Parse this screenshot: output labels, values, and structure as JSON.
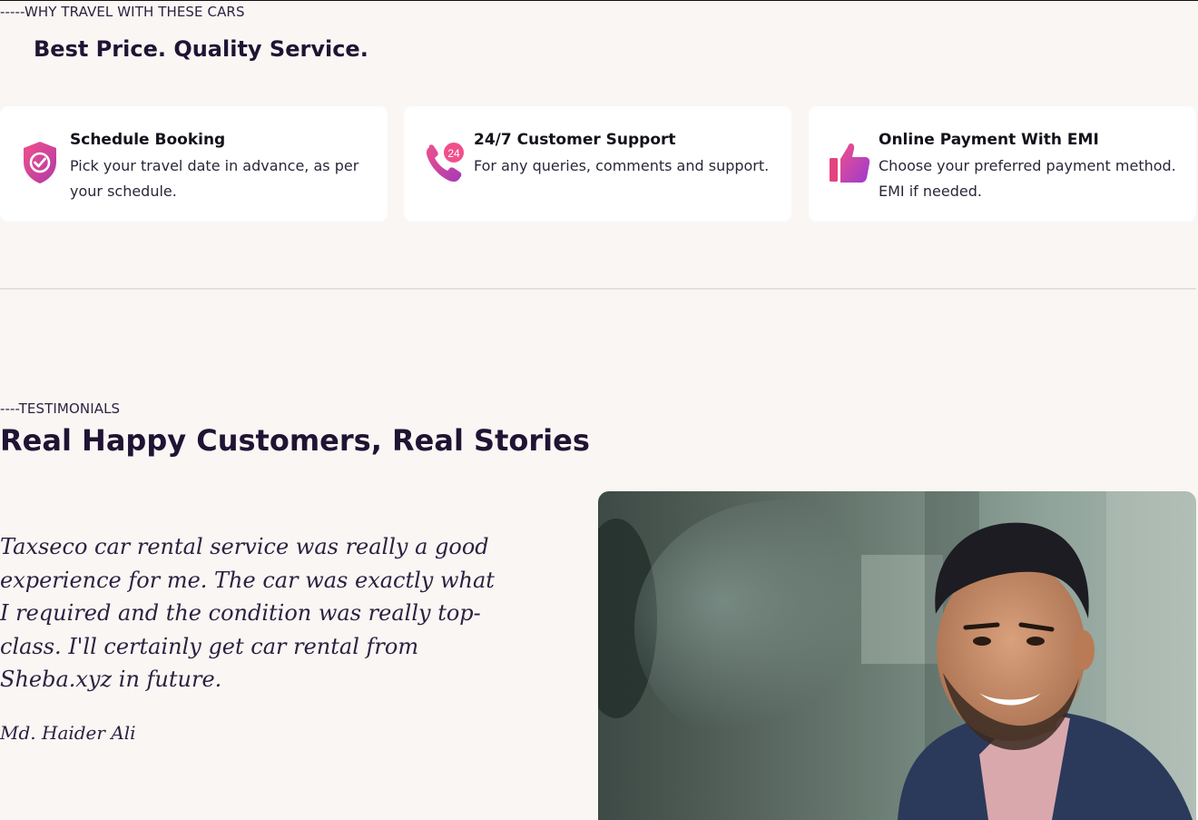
{
  "why_travel": {
    "eyebrow": "-----WHY TRAVEL WITH THESE CARS",
    "title": "Best Price. Quality Service.",
    "features": [
      {
        "icon": "shield-check-icon",
        "title": "Schedule Booking",
        "description": "Pick your travel date in advance, as per your schedule."
      },
      {
        "icon": "phone-24-icon",
        "title": "24/7 Customer Support",
        "description": "For any queries, comments and support."
      },
      {
        "icon": "thumbs-up-icon",
        "title": "Online Payment With EMI",
        "description": "Choose your preferred payment method. EMI if needed."
      }
    ],
    "support_badge": "24"
  },
  "testimonials": {
    "eyebrow": "----TESTIMONIALS",
    "title": "Real Happy Customers, Real Stories",
    "quote": "Taxseco car rental service was really a good experience for me. The car was exactly what I required and the condition was really top-class. I'll certainly get car rental from Sheba.xyz in future.",
    "author": "Md. Haider Ali"
  },
  "colors": {
    "background": "#f9f6f4",
    "heading": "#1f1433",
    "icon_gradient_start": "#e6407f",
    "icon_gradient_end": "#9a3bd1"
  }
}
